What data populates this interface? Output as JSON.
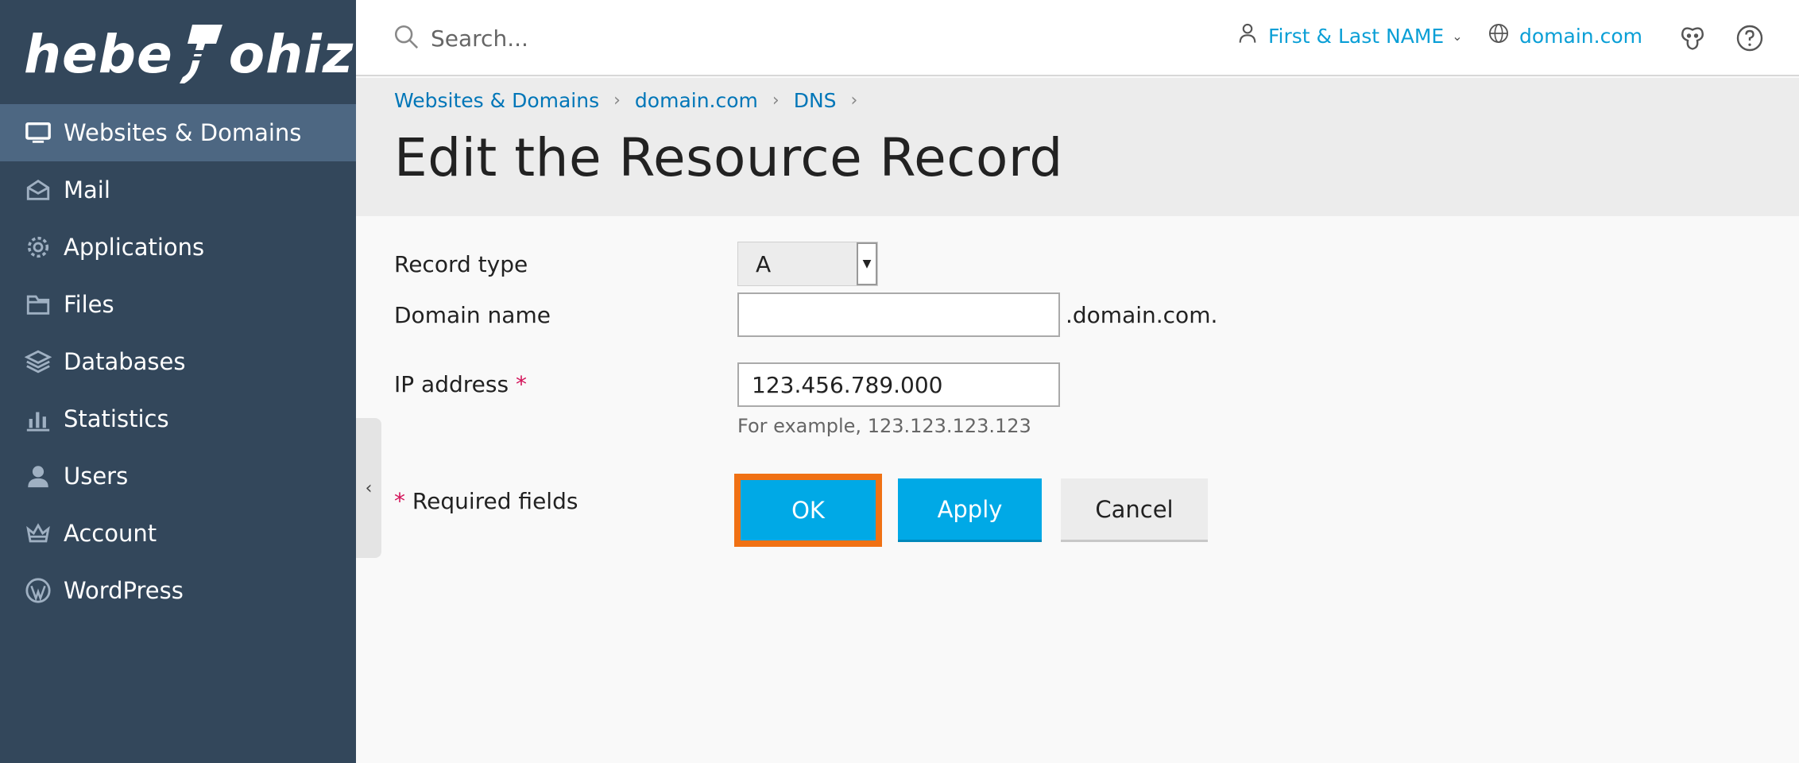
{
  "logo": {
    "text_left": "hebe",
    "text_right": "ohiz"
  },
  "sidebar": {
    "items": [
      {
        "label": "Websites & Domains",
        "icon": "monitor-icon",
        "active": true
      },
      {
        "label": "Mail",
        "icon": "envelope-icon"
      },
      {
        "label": "Applications",
        "icon": "gear-icon"
      },
      {
        "label": "Files",
        "icon": "folder-icon"
      },
      {
        "label": "Databases",
        "icon": "layers-icon"
      },
      {
        "label": "Statistics",
        "icon": "bar-chart-icon"
      },
      {
        "label": "Users",
        "icon": "user-icon"
      },
      {
        "label": "Account",
        "icon": "crown-icon"
      },
      {
        "label": "WordPress",
        "icon": "wordpress-icon"
      }
    ]
  },
  "header": {
    "search_placeholder": "Search...",
    "user_name": "First & Last NAME",
    "domain": "domain.com",
    "icons": [
      "user-icon",
      "globe-icon",
      "extensions-icon",
      "help-icon"
    ]
  },
  "breadcrumb": [
    "Websites & Domains",
    "domain.com",
    "DNS"
  ],
  "page_title": "Edit the Resource Record",
  "form": {
    "record_type_label": "Record type",
    "record_type_value": "A",
    "domain_name_label": "Domain name",
    "domain_name_value": "",
    "domain_suffix": ".domain.com.",
    "ip_label": "IP address",
    "required_mark": "*",
    "ip_value": "123.456.789.000",
    "ip_hint": "For example, 123.123.123.123",
    "required_fields_label": "Required fields"
  },
  "buttons": {
    "ok": "OK",
    "apply": "Apply",
    "cancel": "Cancel"
  },
  "colors": {
    "sidebar": "#33475b",
    "sidebar_active": "#4d6782",
    "accent": "#00a9e6",
    "highlight": "#f07114",
    "link": "#0076b8"
  }
}
